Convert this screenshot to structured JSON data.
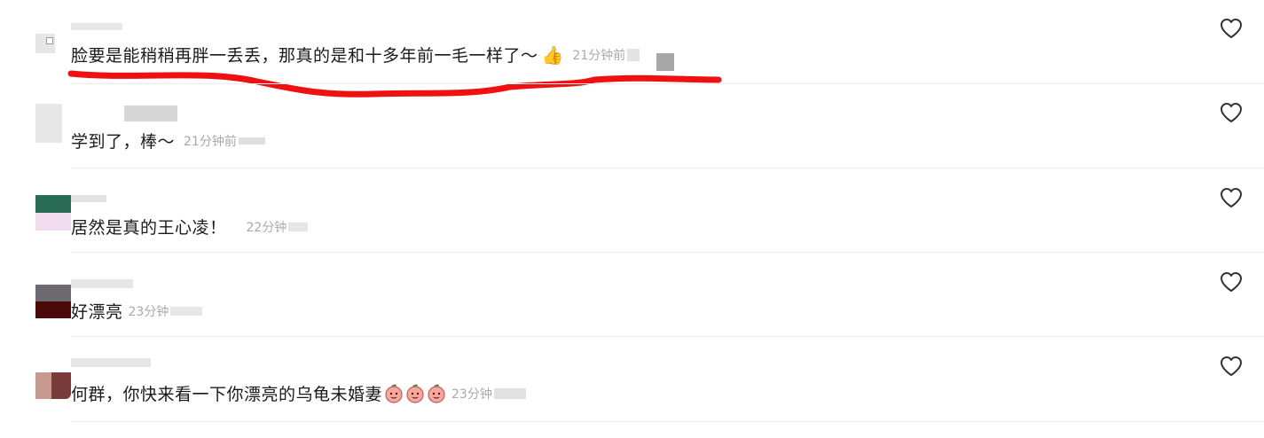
{
  "comments": [
    {
      "name": "",
      "text": "脸要是能稍稍再胖一丢丢，那真的是和十多年前一毛一样了～",
      "emoji": "👍",
      "time": "21分钟前"
    },
    {
      "name": "",
      "text": "学到了，棒～",
      "time": "21分钟前"
    },
    {
      "name": "",
      "text": "居然是真的王心凌！",
      "time": "22分钟"
    },
    {
      "name": "",
      "text": "好漂亮",
      "time": "23分钟"
    },
    {
      "name": "",
      "text": "何群，你快来看一下你漂亮的乌龟未婚妻",
      "time": "23分钟"
    }
  ],
  "colors": {
    "highlight_red": "#ee1111",
    "text": "#1a1a1a",
    "timestamp": "#a9a9a9"
  },
  "icons": {
    "like": "heart-outline-icon",
    "emoji_thumbs": "thumbs-up-icon",
    "emoji_peach": "peach-face-icon"
  }
}
